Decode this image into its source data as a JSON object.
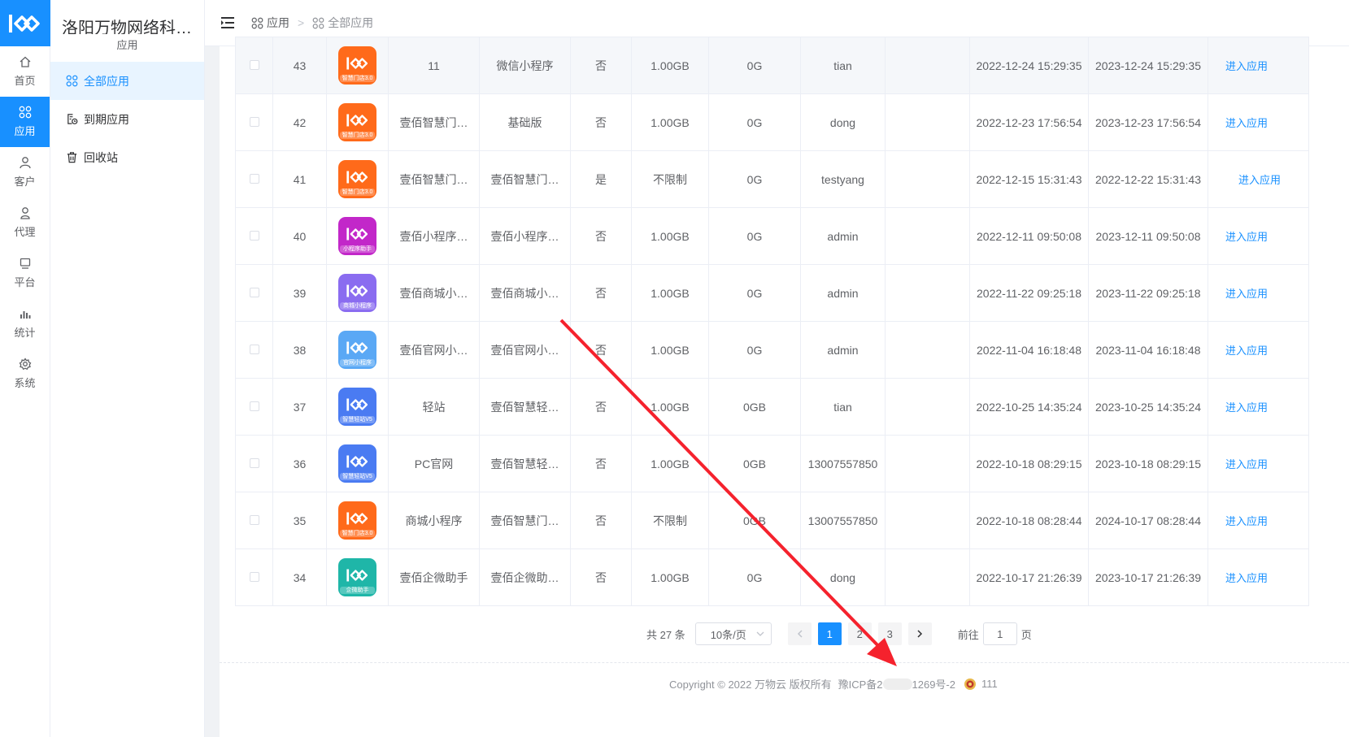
{
  "app": {
    "title": "洛阳万物网络科…",
    "subtitle": "应用"
  },
  "rail": [
    {
      "label": "首页",
      "icon": "home-icon"
    },
    {
      "label": "应用",
      "icon": "apps-icon",
      "active": true
    },
    {
      "label": "客户",
      "icon": "user-icon"
    },
    {
      "label": "代理",
      "icon": "agent-icon"
    },
    {
      "label": "平台",
      "icon": "platform-icon"
    },
    {
      "label": "统计",
      "icon": "chart-icon"
    },
    {
      "label": "系统",
      "icon": "gear-icon"
    }
  ],
  "sidebar": [
    {
      "label": "全部应用",
      "icon": "apps-icon",
      "active": true
    },
    {
      "label": "到期应用",
      "icon": "expire-icon"
    },
    {
      "label": "回收站",
      "icon": "trash-icon"
    }
  ],
  "breadcrumb": {
    "first": "应用",
    "sep": ">",
    "current": "全部应用"
  },
  "rows": [
    {
      "id": "43",
      "icon_text": "智慧门店3.0",
      "icon_color": "#ff6a1a",
      "name": "11",
      "type": "微信小程序",
      "flag": "否",
      "size": "1.00GB",
      "used": "0G",
      "owner": "tian",
      "created": "2022-12-24 15:29:35",
      "expires": "2023-12-24 15:29:35",
      "action": "进入应用"
    },
    {
      "id": "42",
      "icon_text": "智慧门店3.0",
      "icon_color": "#ff6a1a",
      "name": "壹佰智慧门…",
      "type": "基础版",
      "flag": "否",
      "size": "1.00GB",
      "used": "0G",
      "owner": "dong",
      "created": "2022-12-23 17:56:54",
      "expires": "2023-12-23 17:56:54",
      "action": "进入应用"
    },
    {
      "id": "41",
      "icon_text": "智慧门店3.0",
      "icon_color": "#ff6a1a",
      "name": "壹佰智慧门…",
      "type": "壹佰智慧门…",
      "flag": "是",
      "size": "不限制",
      "used": "0G",
      "owner": "testyang",
      "created": "2022-12-15 15:31:43",
      "expires": "2022-12-22 15:31:43",
      "action": "进入应用"
    },
    {
      "id": "40",
      "icon_text": "小程序助手",
      "icon_color": "#c227c9",
      "name": "壹佰小程序…",
      "type": "壹佰小程序…",
      "flag": "否",
      "size": "1.00GB",
      "used": "0G",
      "owner": "admin",
      "created": "2022-12-11 09:50:08",
      "expires": "2023-12-11 09:50:08",
      "action": "进入应用"
    },
    {
      "id": "39",
      "icon_text": "商城小程序",
      "icon_color": "#8a6cf0",
      "name": "壹佰商城小…",
      "type": "壹佰商城小…",
      "flag": "否",
      "size": "1.00GB",
      "used": "0G",
      "owner": "admin",
      "created": "2022-11-22 09:25:18",
      "expires": "2023-11-22 09:25:18",
      "action": "进入应用"
    },
    {
      "id": "38",
      "icon_text": "官网小程序",
      "icon_color": "#5aa8f5",
      "name": "壹佰官网小…",
      "type": "壹佰官网小…",
      "flag": "否",
      "size": "1.00GB",
      "used": "0G",
      "owner": "admin",
      "created": "2022-11-04 16:18:48",
      "expires": "2023-11-04 16:18:48",
      "action": "进入应用"
    },
    {
      "id": "37",
      "icon_text": "智慧轻站V5",
      "icon_color": "#4a7bf2",
      "name": "轻站",
      "type": "壹佰智慧轻…",
      "flag": "否",
      "size": "1.00GB",
      "used": "0GB",
      "owner": "tian",
      "created": "2022-10-25 14:35:24",
      "expires": "2023-10-25 14:35:24",
      "action": "进入应用"
    },
    {
      "id": "36",
      "icon_text": "智慧轻站V5",
      "icon_color": "#4a7bf2",
      "name": "PC官网",
      "type": "壹佰智慧轻…",
      "flag": "否",
      "size": "1.00GB",
      "used": "0GB",
      "owner": "13007557850",
      "created": "2022-10-18 08:29:15",
      "expires": "2023-10-18 08:29:15",
      "action": "进入应用"
    },
    {
      "id": "35",
      "icon_text": "智慧门店3.0",
      "icon_color": "#ff6a1a",
      "name": "商城小程序",
      "type": "壹佰智慧门…",
      "flag": "否",
      "size": "不限制",
      "used": "0GB",
      "owner": "13007557850",
      "created": "2022-10-18 08:28:44",
      "expires": "2024-10-17 08:28:44",
      "action": "进入应用"
    },
    {
      "id": "34",
      "icon_text": "企微助手",
      "icon_color": "#1fb6a8",
      "name": "壹佰企微助手",
      "type": "壹佰企微助…",
      "flag": "否",
      "size": "1.00GB",
      "used": "0G",
      "owner": "dong",
      "created": "2022-10-17 21:26:39",
      "expires": "2023-10-17 21:26:39",
      "action": "进入应用"
    }
  ],
  "pagination": {
    "total": "共 27 条",
    "page_size": "10条/页",
    "pages": [
      "1",
      "2",
      "3"
    ],
    "current": "1",
    "goto_label": "前往",
    "goto_value": "1",
    "page_suffix": "页"
  },
  "footer": {
    "copyright": "Copyright © 2022 万物云 版权所有",
    "icp_prefix": "豫ICP备2",
    "icp_suffix": "1269号-2",
    "police": "111"
  },
  "colors": {
    "accent": "#1890ff",
    "annotation": "#f5222d"
  }
}
